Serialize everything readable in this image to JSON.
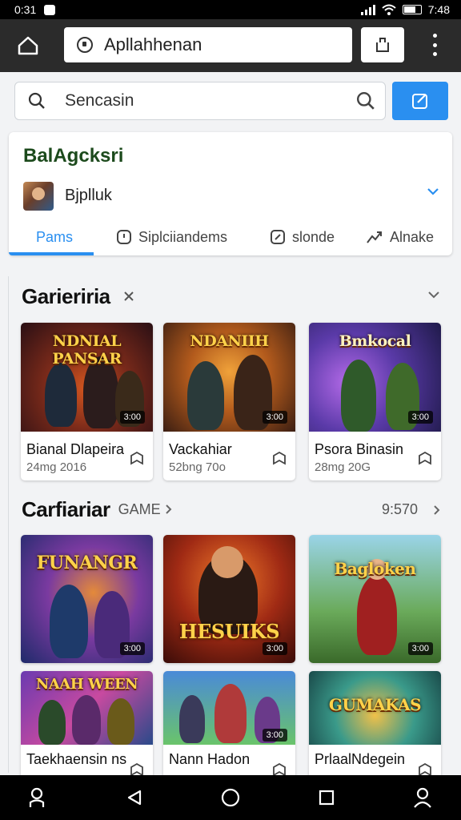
{
  "status": {
    "time": "0:31",
    "right_time": "7:48"
  },
  "browser": {
    "url": "Apllahhenan"
  },
  "search": {
    "placeholder": "Sencasin"
  },
  "account": {
    "title": "BalAgcksri",
    "name": "Bjplluk",
    "tabs": [
      "Pams",
      "Siplciiandems",
      "slonde",
      "Alnake"
    ]
  },
  "section1": {
    "title": "Garieriria",
    "cards": [
      {
        "art": "NDNIAL PANSAR",
        "name": "Bianal Dlapeira",
        "meta": "24mg 2016",
        "badge": "3:00",
        "bg": "#3a1c18"
      },
      {
        "art": "NDANIIH",
        "name": "Vackahiar",
        "meta": "52bng 70o",
        "badge": "3:00",
        "bg": "#6b3a14"
      },
      {
        "art": "Bmkocal",
        "name": "Psora Binasin",
        "meta": "28mg 20G",
        "badge": "3:00",
        "bg": "#3b2a6e"
      }
    ]
  },
  "section2": {
    "title": "Carfiariar",
    "subtitle": "GAME",
    "count": "9:570",
    "cards": [
      {
        "art": "FUNANGR",
        "name": "",
        "meta": "",
        "badge": "3:00",
        "bg": "#2a2a6e"
      },
      {
        "art": "HESUIKS",
        "name": "",
        "meta": "",
        "badge": "3:00",
        "bg": "#6a1e10"
      },
      {
        "art": "Bagloken",
        "name": "",
        "meta": "",
        "badge": "3:00",
        "bg": "#3f7a8a"
      }
    ]
  },
  "section3": {
    "cards": [
      {
        "art": "NAAH WEEN",
        "name": "Taekhaensin ns",
        "bg": "#4a2a8a"
      },
      {
        "art": "",
        "name": "Nann Hadon",
        "bg": "#3a7ab0"
      },
      {
        "art": "GUMAKAS",
        "name": "PrlaalNdegein",
        "bg": "#2f7a6a"
      }
    ]
  }
}
